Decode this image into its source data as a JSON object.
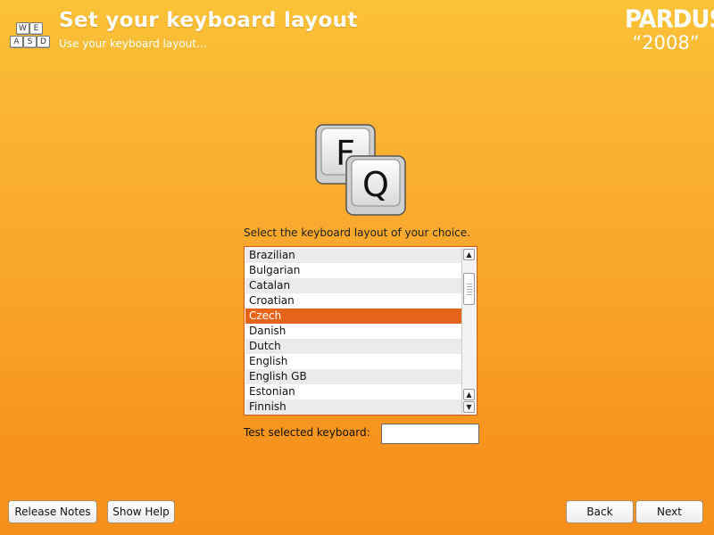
{
  "header": {
    "title": "Set your keyboard layout",
    "subtitle": "Use your keyboard layout...",
    "icon": "keyboard-keys-icon",
    "icon_keys": [
      "W",
      "E",
      "A",
      "S",
      "D"
    ]
  },
  "logo": {
    "brand": "PARDUS",
    "year": "“2008”"
  },
  "hero": {
    "icon": "keyboard-layout-fq-icon",
    "key1": "F",
    "key2": "Q"
  },
  "prompt": "Select the keyboard layout of your choice.",
  "layouts": {
    "items": [
      "Brazilian",
      "Bulgarian",
      "Catalan",
      "Croatian",
      "Czech",
      "Danish",
      "Dutch",
      "English",
      "English GB",
      "Estonian",
      "Finnish"
    ],
    "selected": "Czech"
  },
  "test": {
    "label": "Test selected keyboard:",
    "value": ""
  },
  "buttons": {
    "release_notes": "Release Notes",
    "show_help": "Show Help",
    "back": "Back",
    "next": "Next"
  },
  "colors": {
    "background_top": "#fbc237",
    "background_bottom": "#f79019",
    "selection": "#e6641a",
    "list_border": "#d35a0f"
  }
}
